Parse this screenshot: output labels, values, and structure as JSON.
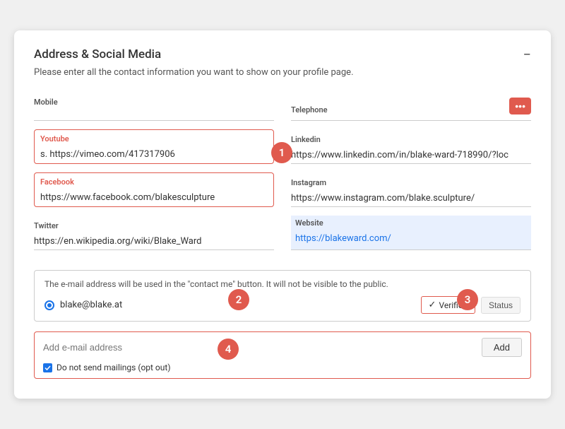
{
  "card": {
    "title": "Address & Social Media",
    "subtitle": "Please enter all the contact information you want to show on your profile page.",
    "collapse_icon": "−"
  },
  "fields": {
    "mobile": {
      "label": "Mobile",
      "value": "",
      "placeholder": ""
    },
    "telephone": {
      "label": "Telephone",
      "value": "",
      "placeholder": ""
    },
    "youtube": {
      "label": "Youtube",
      "value": "s. https://vimeo.com/417317906",
      "highlighted": true
    },
    "linkedin": {
      "label": "Linkedin",
      "value": "https://www.linkedin.com/in/blake-ward-718990/?loc"
    },
    "facebook": {
      "label": "Facebook",
      "value": "https://www.facebook.com/blakesculpture",
      "highlighted": true
    },
    "instagram": {
      "label": "Instagram",
      "value": "https://www.instagram.com/blake.sculpture/"
    },
    "twitter": {
      "label": "Twitter",
      "value": "https://en.wikipedia.org/wiki/Blake_Ward"
    },
    "website": {
      "label": "Website",
      "value": "https://blakeward.com/",
      "highlighted_bg": true
    }
  },
  "email_section": {
    "notice": "The e-mail address will be used in the \"contact me\" button. It will not be visible to the public.",
    "email": "blake@blake.at",
    "verified_label": "Verified",
    "status_label": "Status",
    "add_placeholder": "Add e-mail address",
    "add_button": "Add",
    "opt_out_label": "Do not send mailings (opt out)"
  },
  "numbered_circles": [
    {
      "id": 1,
      "label": "1"
    },
    {
      "id": 2,
      "label": "2"
    },
    {
      "id": 3,
      "label": "3"
    },
    {
      "id": 4,
      "label": "4"
    }
  ]
}
